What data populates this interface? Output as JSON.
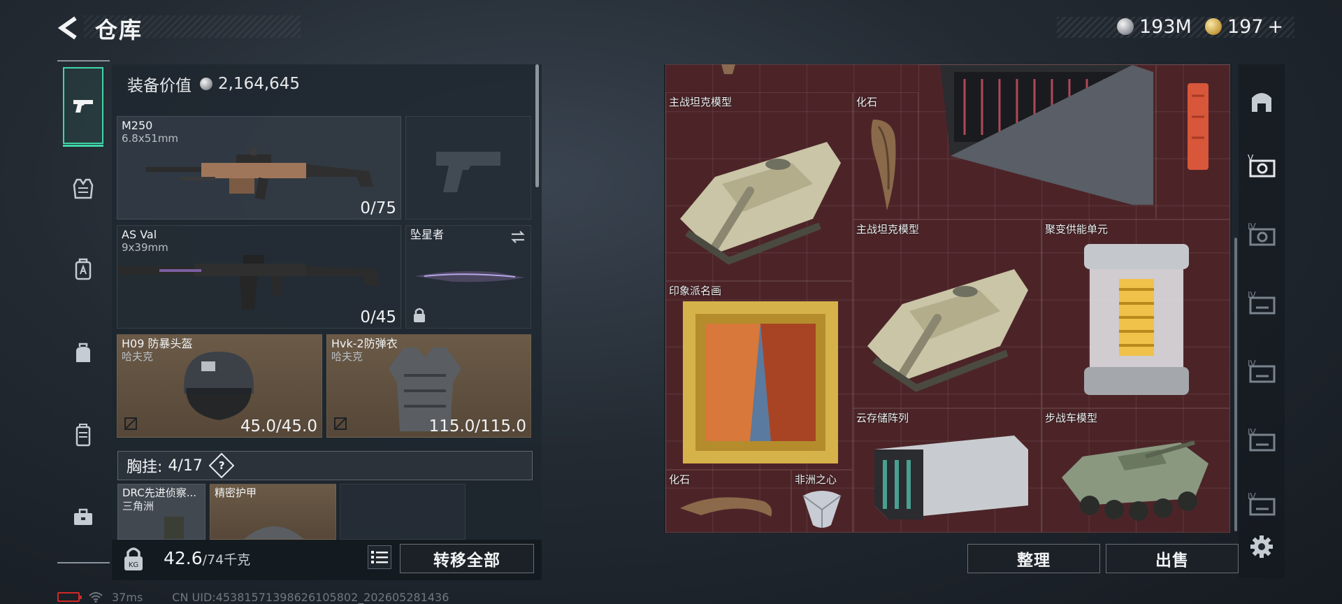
{
  "header": {
    "title": "仓库",
    "currency_silver": "193M",
    "currency_gold": "197",
    "currency_add": "+"
  },
  "equipment": {
    "value_label": "装备价值",
    "value": "2,164,645",
    "primary_weapon": {
      "name": "M250",
      "caliber": "6.8x51mm",
      "ammo": "0/75"
    },
    "secondary_weapon": {
      "name": "AS Val",
      "caliber": "9x39mm",
      "ammo": "0/45"
    },
    "melee": {
      "name": "坠星者"
    },
    "helmet": {
      "name": "H09 防暴头盔",
      "maker": "哈夫克",
      "durability": "45.0/45.0"
    },
    "armor": {
      "name": "Hvk-2防弹衣",
      "maker": "哈夫克",
      "durability": "115.0/115.0"
    },
    "chest_rig": {
      "label": "胸挂:",
      "capacity": "4/17"
    },
    "rig_items": [
      {
        "name": "DRC先进侦察...",
        "sub": "三角洲"
      },
      {
        "name": "精密护甲",
        "sub": ""
      }
    ],
    "weight": "42.6",
    "weight_max": "/74千克",
    "transfer_all": "转移全部"
  },
  "status": {
    "ping": "37ms",
    "uid": "CN UID:45381571398626105802_202605281436"
  },
  "storage": {
    "items": [
      {
        "name": "主战坦克模型"
      },
      {
        "name": "化石"
      },
      {
        "name": "主战坦克模型"
      },
      {
        "name": "聚变供能单元"
      },
      {
        "name": "印象派名画"
      },
      {
        "name": "云存储阵列"
      },
      {
        "name": "步战车模型"
      },
      {
        "name": "化石"
      },
      {
        "name": "非洲之心"
      }
    ],
    "sort_label": "整理",
    "sell_label": "出售"
  },
  "colors": {
    "accent": "#3fd6a8",
    "grid_bg": "#4c2428",
    "item_bg": "#6b5a47"
  },
  "icons": {
    "left_nav": [
      "pistol-icon",
      "vest-icon",
      "backpack-armor-icon",
      "bag-icon",
      "locker-icon",
      "toolbox-icon"
    ],
    "right_nav": [
      "storage-arch-icon",
      "storage-v-icon",
      "storage-iv-icon",
      "storage-iv-icon",
      "storage-iv-icon",
      "storage-iv-icon",
      "storage-iv-icon",
      "settings-gear-icon"
    ]
  }
}
